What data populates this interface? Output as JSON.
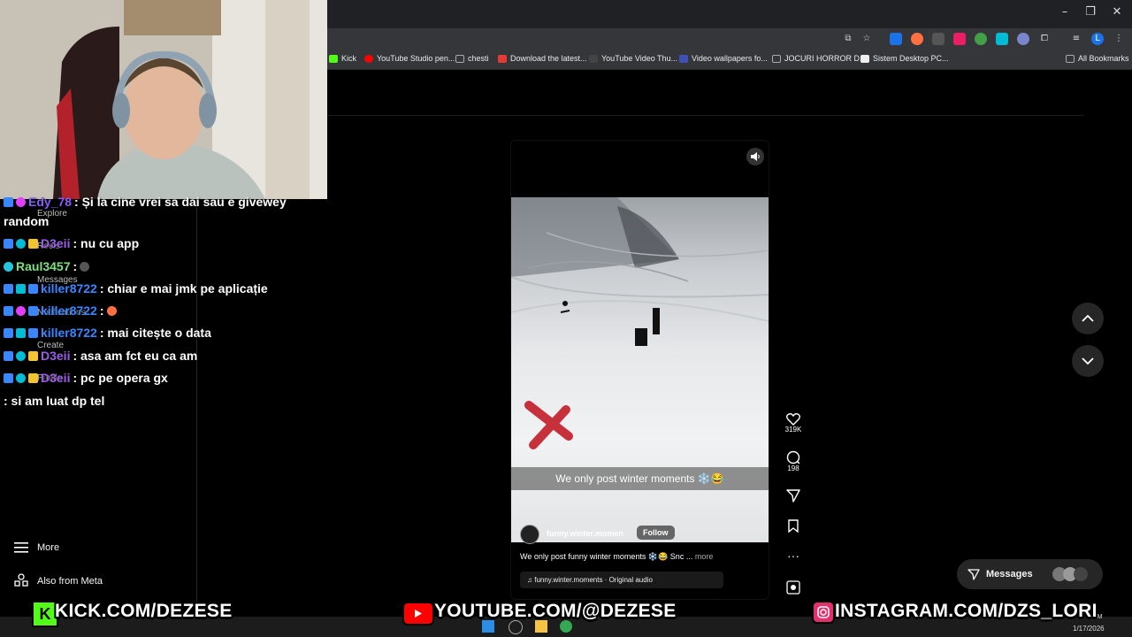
{
  "browser": {
    "bookmarks": [
      {
        "label": "Kick",
        "icon": "kick-icon",
        "color": "#53fc18"
      },
      {
        "label": "YouTube Studio pen...",
        "icon": "youtube-icon",
        "color": "#ff0000"
      },
      {
        "label": "chesti",
        "icon": "folder-icon",
        "color": "#aaaaaa"
      },
      {
        "label": "Download the latest...",
        "icon": "page-icon",
        "color": "#e53935"
      },
      {
        "label": "YouTube Video Thu...",
        "icon": "page-icon",
        "color": "#444444"
      },
      {
        "label": "Video wallpapers fo...",
        "icon": "page-icon",
        "color": "#3f51b5"
      },
      {
        "label": "JOCURI HORROR D...",
        "icon": "folder-icon",
        "color": "#aaaaaa"
      },
      {
        "label": "Sistem Desktop PC...",
        "icon": "page-icon",
        "color": "#eeeeee"
      }
    ],
    "all_bookmarks": "All Bookmarks",
    "profile_initial": "L"
  },
  "chat": [
    {
      "user": "Edy_78",
      "user_color": "#8a5cf6",
      "text": ": Și la cine vrei sa dai sau e givewey",
      "cont": "random"
    },
    {
      "user": "D3eii",
      "user_color": "#9b5de5",
      "text": ": nu cu app"
    },
    {
      "user": "Raul3457",
      "user_color": "#7ee081",
      "text": ":"
    },
    {
      "user": "killer8722",
      "user_color": "#3a86ff",
      "text": ": chiar e mai jmk pe aplicație"
    },
    {
      "user": "killer8722",
      "user_color": "#3a86ff",
      "text": ":"
    },
    {
      "user": "killer8722",
      "user_color": "#3a86ff",
      "text": ": mai citește o data"
    },
    {
      "user": "D3eii",
      "user_color": "#9b5de5",
      "text": ": asa am fct eu ca am"
    },
    {
      "user": "D3eii",
      "user_color": "#9b5de5",
      "text": ": pc pe opera gx"
    },
    {
      "user": "",
      "user_color": "#ffffff",
      "text": ": si am luat dp tel"
    }
  ],
  "sidebar": {
    "ghost_items": [
      "Explore",
      "Reels",
      "Messages",
      "Notifications",
      "Create",
      "Profile"
    ],
    "more": "More",
    "also_from_meta": "Also from Meta"
  },
  "reel": {
    "overlay_caption": "We only post winter moments ❄️😂",
    "username": "funny.winter.momen",
    "follow": "Follow",
    "caption": "We only post funny winter moments ❄️😂 Snc ...",
    "more": "more",
    "audio": "funny.winter.moments · Original audio"
  },
  "actions": {
    "likes": "319K",
    "comments": "198"
  },
  "messages_pill": "Messages",
  "overlay": {
    "kick": "KICK.COM/DEZESE",
    "youtube": "YOUTUBE.COM/@DEZESE",
    "instagram": "INSTAGRAM.COM/DZS_LORI"
  },
  "taskbar": {
    "date": "1/17/2026",
    "time": "PM"
  },
  "colors": {
    "kick_green": "#53fc18",
    "youtube_red": "#ff0000",
    "instagram_pink": "#e1306c",
    "follow_bg": "#3a3a3a"
  }
}
